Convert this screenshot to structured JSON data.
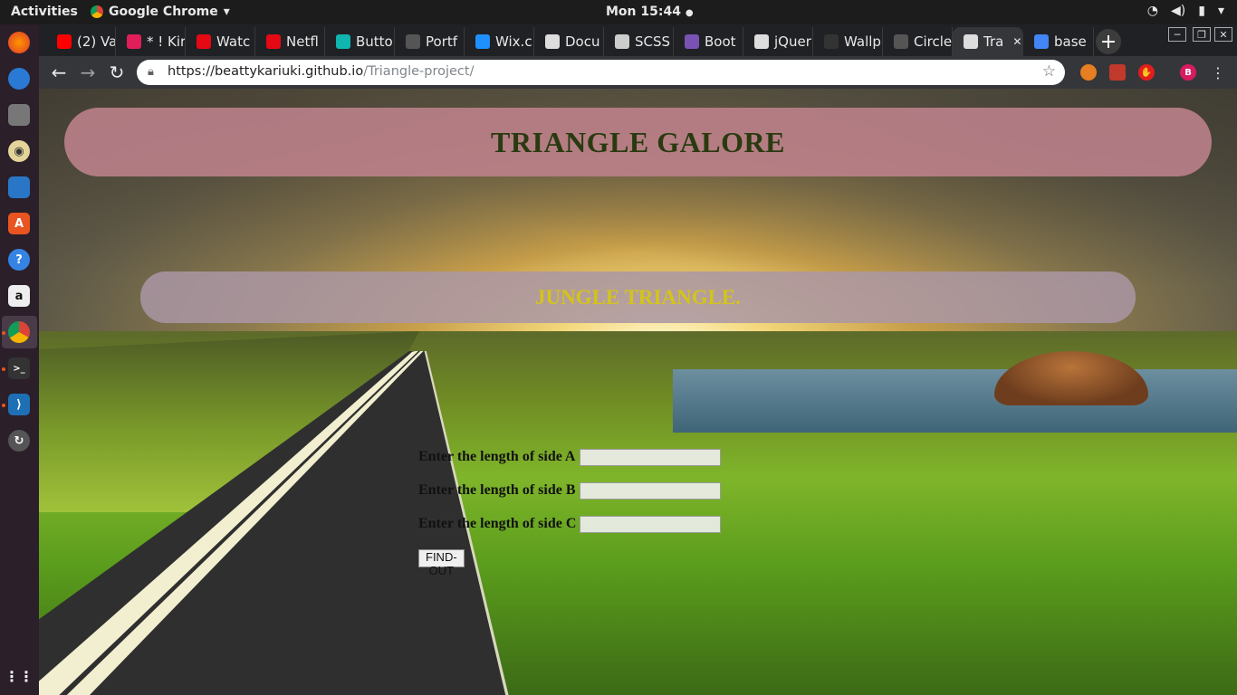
{
  "system": {
    "activities_label": "Activities",
    "app_name": "Google Chrome",
    "clock": "Mon 15:44",
    "clock_indicator": "●"
  },
  "browser": {
    "tabs": [
      {
        "label": "(2) Va",
        "icon": "youtube-icon",
        "color": "#ff0000"
      },
      {
        "label": "* ! Kir",
        "icon": "slack-icon",
        "color": "#e01e5a"
      },
      {
        "label": "Watc",
        "icon": "play-icon",
        "color": "#e50914"
      },
      {
        "label": "Netfl",
        "icon": "netflix-icon",
        "color": "#e50914"
      },
      {
        "label": "Butto",
        "icon": "s-icon",
        "color": "#0fb5ae"
      },
      {
        "label": "Portf",
        "icon": "hex-icon",
        "color": "#555555"
      },
      {
        "label": "Wix.c",
        "icon": "wix-icon",
        "color": "#1e90ff"
      },
      {
        "label": "Docu",
        "icon": "doc-icon",
        "color": "#dddddd"
      },
      {
        "label": "SCSS",
        "icon": "scss-icon",
        "color": "#cccccc"
      },
      {
        "label": "Boot",
        "icon": "bootstrap-icon",
        "color": "#7952b3"
      },
      {
        "label": "jQuer",
        "icon": "doc-icon",
        "color": "#dddddd"
      },
      {
        "label": "Wallp",
        "icon": "wallpaper-icon",
        "color": "#333333"
      },
      {
        "label": "Circle",
        "icon": "hex-icon",
        "color": "#555555"
      },
      {
        "label": "Tra",
        "icon": "doc-icon",
        "color": "#dddddd",
        "active": true
      },
      {
        "label": "base",
        "icon": "google-icon",
        "color": "#4285f4"
      }
    ],
    "url_host": "https://beattykariuki.github.io",
    "url_path": "/Triangle-project/",
    "new_tab_label": "+"
  },
  "page": {
    "title": "TRIANGLE GALORE",
    "result": "JUNGLE TRIANGLE.",
    "side_a_label": "Enter the length of side A",
    "side_b_label": "Enter the length of side B",
    "side_c_label": "Enter the length of side C",
    "side_a_value": "",
    "side_b_value": "",
    "side_c_value": "",
    "button_label": "FIND-OUT"
  },
  "colors": {
    "title_banner": "#be828c",
    "title_text": "#2a3a10",
    "result_text": "#d4c418"
  }
}
